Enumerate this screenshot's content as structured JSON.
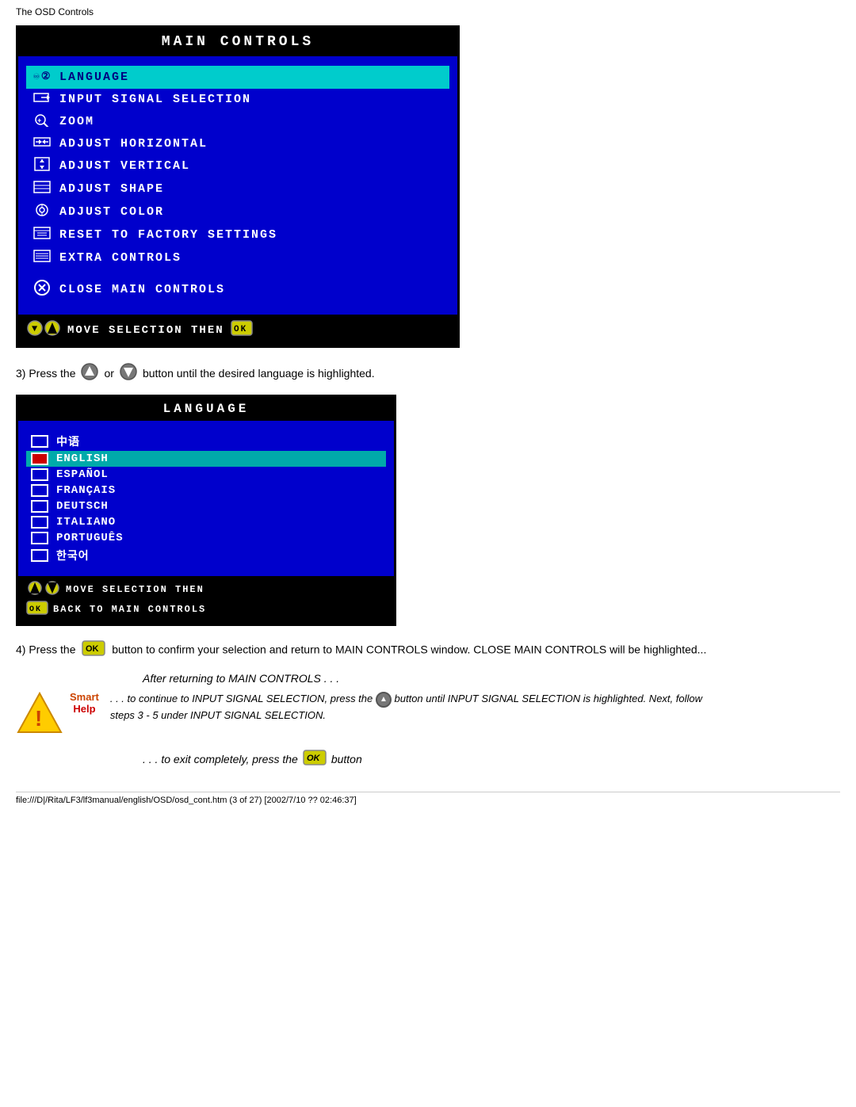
{
  "page": {
    "title": "The OSD Controls",
    "footer": "file:///D|/Rita/LF3/lf3manual/english/OSD/osd_cont.htm (3 of 27) [2002/7/10 ?? 02:46:37]"
  },
  "mainControls": {
    "header": "MAIN  CONTROLS",
    "items": [
      {
        "id": "language",
        "label": "LANGUAGE",
        "active": true
      },
      {
        "id": "input",
        "label": "INPUT  SIGNAL  SELECTION",
        "active": false
      },
      {
        "id": "zoom",
        "label": "ZOOM",
        "active": false
      },
      {
        "id": "horiz",
        "label": "ADJUST  HORIZONTAL",
        "active": false
      },
      {
        "id": "vert",
        "label": "ADJUST  VERTICAL",
        "active": false
      },
      {
        "id": "shape",
        "label": "ADJUST  SHAPE",
        "active": false
      },
      {
        "id": "color",
        "label": "ADJUST  COLOR",
        "active": false
      },
      {
        "id": "reset",
        "label": "RESET  TO  FACTORY  SETTINGS",
        "active": false
      },
      {
        "id": "extra",
        "label": "EXTRA  CONTROLS",
        "active": false
      }
    ],
    "closeLabel": "CLOSE  MAIN  CONTROLS",
    "footer": "MOVE  SELECTION  THEN"
  },
  "instruction3": {
    "text1": "3) Press the",
    "text2": "or",
    "text3": "button until the desired language is highlighted."
  },
  "language": {
    "header": "LANGUAGE",
    "items": [
      {
        "id": "chinese",
        "label": "中语",
        "active": false
      },
      {
        "id": "english",
        "label": "ENGLISH",
        "active": true
      },
      {
        "id": "spanish",
        "label": "ESPAÑOL",
        "active": false
      },
      {
        "id": "french",
        "label": "FRANÇAIS",
        "active": false
      },
      {
        "id": "german",
        "label": "DEUTSCH",
        "active": false
      },
      {
        "id": "italian",
        "label": "ITALIANO",
        "active": false
      },
      {
        "id": "portuguese",
        "label": "PORTUGUÊS",
        "active": false
      },
      {
        "id": "korean",
        "label": "한국어",
        "active": false
      }
    ],
    "footer1": "MOVE SELECTION THEN",
    "footer2": "BACK TO MAIN CONTROLS"
  },
  "instruction4": {
    "text": "4) Press the",
    "text2": "button to confirm your selection and return to MAIN CONTROLS window. CLOSE MAIN CONTROLS will be highlighted..."
  },
  "afterReturning": "After returning to MAIN CONTROLS . . .",
  "smartHelp": {
    "bullet1": ". . . to continue to INPUT SIGNAL SELECTION, press the",
    "bullet1b": "button until INPUT SIGNAL SELECTION is highlighted. Next, follow steps 3 - 5 under INPUT SIGNAL SELECTION.",
    "bullet2": ". . . to exit completely, press the",
    "bullet2b": "button"
  }
}
